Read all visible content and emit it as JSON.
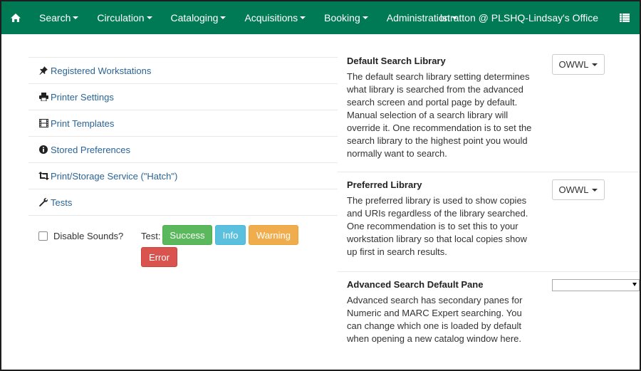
{
  "navbar": {
    "menus": [
      {
        "label": "Search"
      },
      {
        "label": "Circulation"
      },
      {
        "label": "Cataloging"
      },
      {
        "label": "Acquisitions"
      },
      {
        "label": "Booking"
      },
      {
        "label": "Administration"
      }
    ],
    "user_label": "lstratton @ PLSHQ-Lindsay's Office",
    "bg_color": "#007a54"
  },
  "left": {
    "links": [
      {
        "label": "Registered Workstations",
        "icon": "pushpin-icon"
      },
      {
        "label": "Printer Settings",
        "icon": "printer-icon"
      },
      {
        "label": "Print Templates",
        "icon": "film-icon"
      },
      {
        "label": "Stored Preferences",
        "icon": "info-circle-icon"
      },
      {
        "label": "Print/Storage Service (\"Hatch\")",
        "icon": "retweet-icon"
      },
      {
        "label": "Tests",
        "icon": "wrench-icon"
      }
    ],
    "disable_sounds_label": "Disable Sounds?",
    "test_label": "Test:",
    "buttons": {
      "success": "Success",
      "info": "Info",
      "warning": "Warning",
      "error": "Error"
    }
  },
  "right": {
    "settings": [
      {
        "title": "Default Search Library",
        "description": "The default search library setting determines what library is searched from the advanced search screen and portal page by default. Manual selection of a search library will override it. One recommendation is to set the search library to the highest point you would normally want to search.",
        "value": "OWWL"
      },
      {
        "title": "Preferred Library",
        "description": "The preferred library is used to show copies and URIs regardless of the library searched. One recommendation is to set this to your workstation library so that local copies show up first in search results.",
        "value": "OWWL"
      },
      {
        "title": "Advanced Search Default Pane",
        "description": "Advanced search has secondary panes for Numeric and MARC Expert searching. You can change which one is loaded by default when opening a new catalog window here.",
        "value": ""
      }
    ]
  },
  "colors": {
    "link": "#2a6496",
    "success": "#5cb85c",
    "info": "#5bc0de",
    "warning": "#f0ad4e",
    "danger": "#d9534f"
  }
}
